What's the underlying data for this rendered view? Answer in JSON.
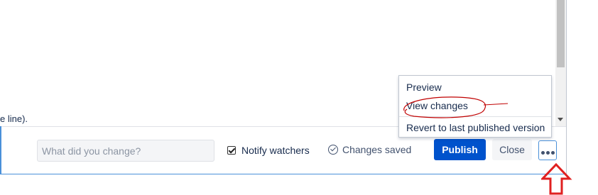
{
  "editor": {
    "text_fragment": "e line)."
  },
  "footer": {
    "change_input": {
      "value": "",
      "placeholder": "What did you change?"
    },
    "notify_label": "Notify watchers",
    "notify_checked": true,
    "saved_label": "Changes saved",
    "publish_label": "Publish",
    "close_label": "Close"
  },
  "menu": {
    "items": [
      {
        "label": "Preview"
      },
      {
        "label": "View changes"
      },
      {
        "label": "Revert to last published version"
      }
    ]
  },
  "icons": {
    "saved": "check-circle-icon",
    "more": "more-options-icon",
    "arrow": "up-arrow-annotation-icon"
  },
  "colors": {
    "primary": "#0052cc",
    "annotation": "#c00000",
    "focus_border": "#4a90d9"
  }
}
